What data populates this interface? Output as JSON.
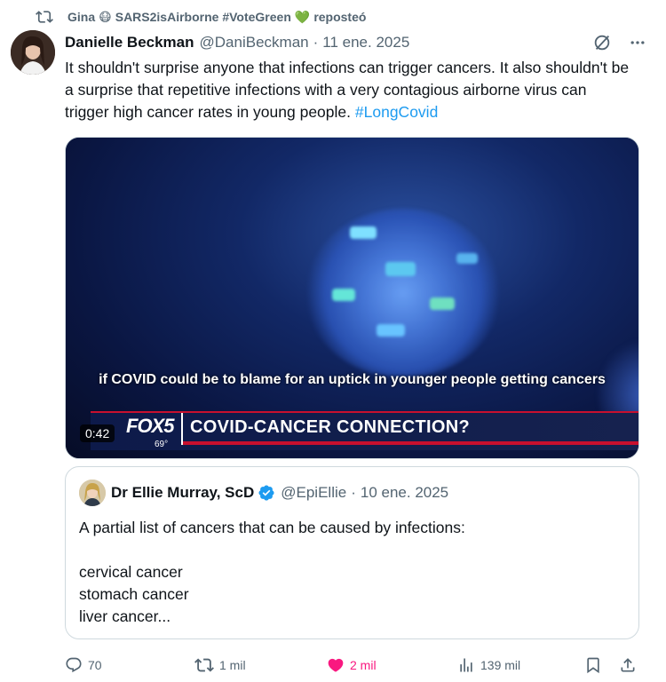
{
  "repost": {
    "user": "Gina",
    "emoji": "😷",
    "handle_text": "SARS2isAirborne #VoteGreen",
    "emoji2": "💚",
    "action": "reposteó"
  },
  "tweet": {
    "author_name": "Danielle Beckman",
    "author_handle": "@DaniBeckman",
    "separator": "·",
    "date": "11 ene. 2025",
    "text_main": "It shouldn't surprise anyone that infections can trigger cancers. It also shouldn't be a surprise that repetitive infections with a very contagious airborne virus can trigger high cancer rates in young people.",
    "hashtag": "#LongCovid"
  },
  "video": {
    "caption": "if COVID could be to blame for an uptick in younger people getting cancers",
    "logo": "FOX5",
    "temperature": "69°",
    "headline": "COVID-CANCER CONNECTION?",
    "duration": "0:42"
  },
  "quote": {
    "author_name": "Dr Ellie Murray, ScD",
    "author_handle": "@EpiEllie",
    "separator": "·",
    "date": "10 ene. 2025",
    "lines": [
      "A partial list of cancers that can be caused by infections:",
      "",
      "cervical cancer",
      "stomach cancer",
      "liver cancer..."
    ]
  },
  "actions": {
    "replies": "70",
    "reposts": "1 mil",
    "likes": "2 mil",
    "views": "139 mil"
  },
  "colors": {
    "accent": "#1d9bf0",
    "like": "#f91880",
    "muted": "#536471",
    "text": "#0f1419"
  }
}
